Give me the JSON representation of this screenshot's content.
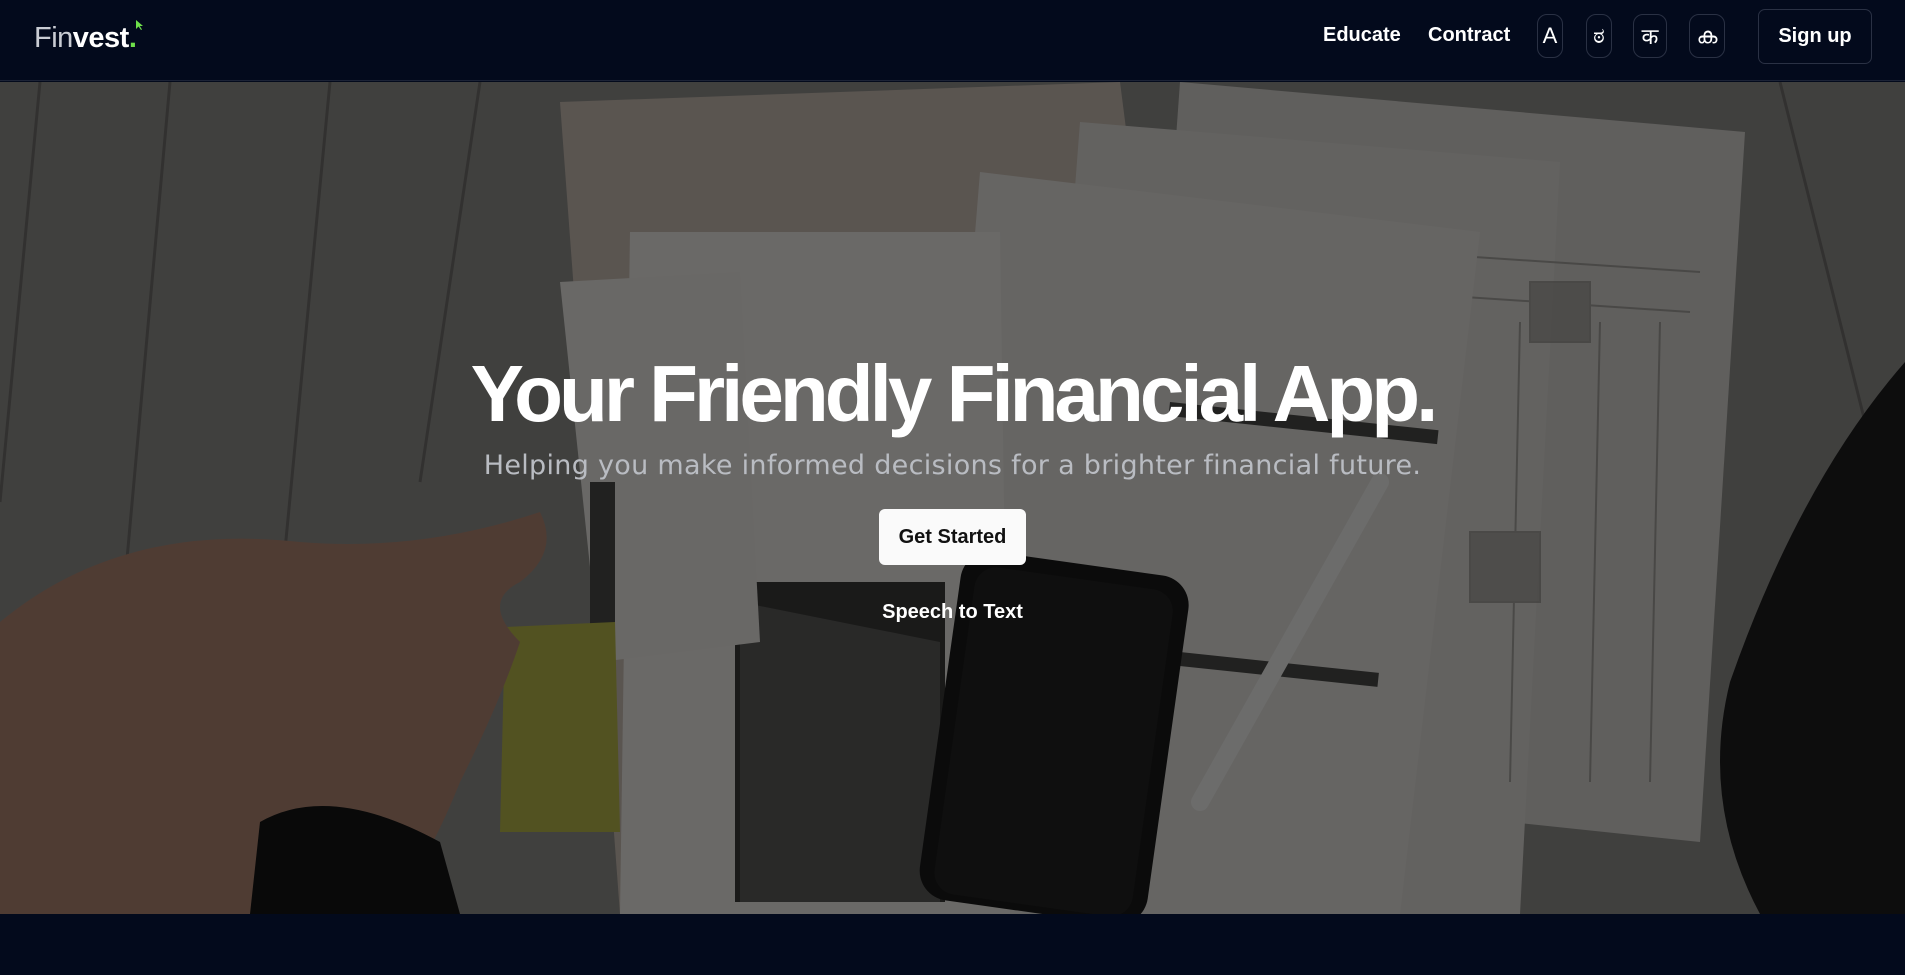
{
  "logo": {
    "part1": "Fin",
    "part2": "vest",
    "dot": "."
  },
  "nav": {
    "educate": "Educate",
    "contract": "Contract",
    "languages": [
      {
        "label": "A",
        "icon": "latin-a"
      },
      {
        "label": "ಠ",
        "icon": "kannada-glyph"
      },
      {
        "label": "क",
        "icon": "devanagari-ka"
      },
      {
        "label": "ക",
        "icon": "malayalam-glyph"
      }
    ],
    "signup": "Sign up"
  },
  "hero": {
    "title": "Your Friendly Financial App.",
    "subtitle": "Helping you make informed decisions for a brighter financial future.",
    "cta": "Get Started",
    "speech": "Speech to Text"
  },
  "colors": {
    "navbar_bg": "#030a1c",
    "accent_dot": "#6ee04a",
    "cta_bg": "#fafafa"
  }
}
